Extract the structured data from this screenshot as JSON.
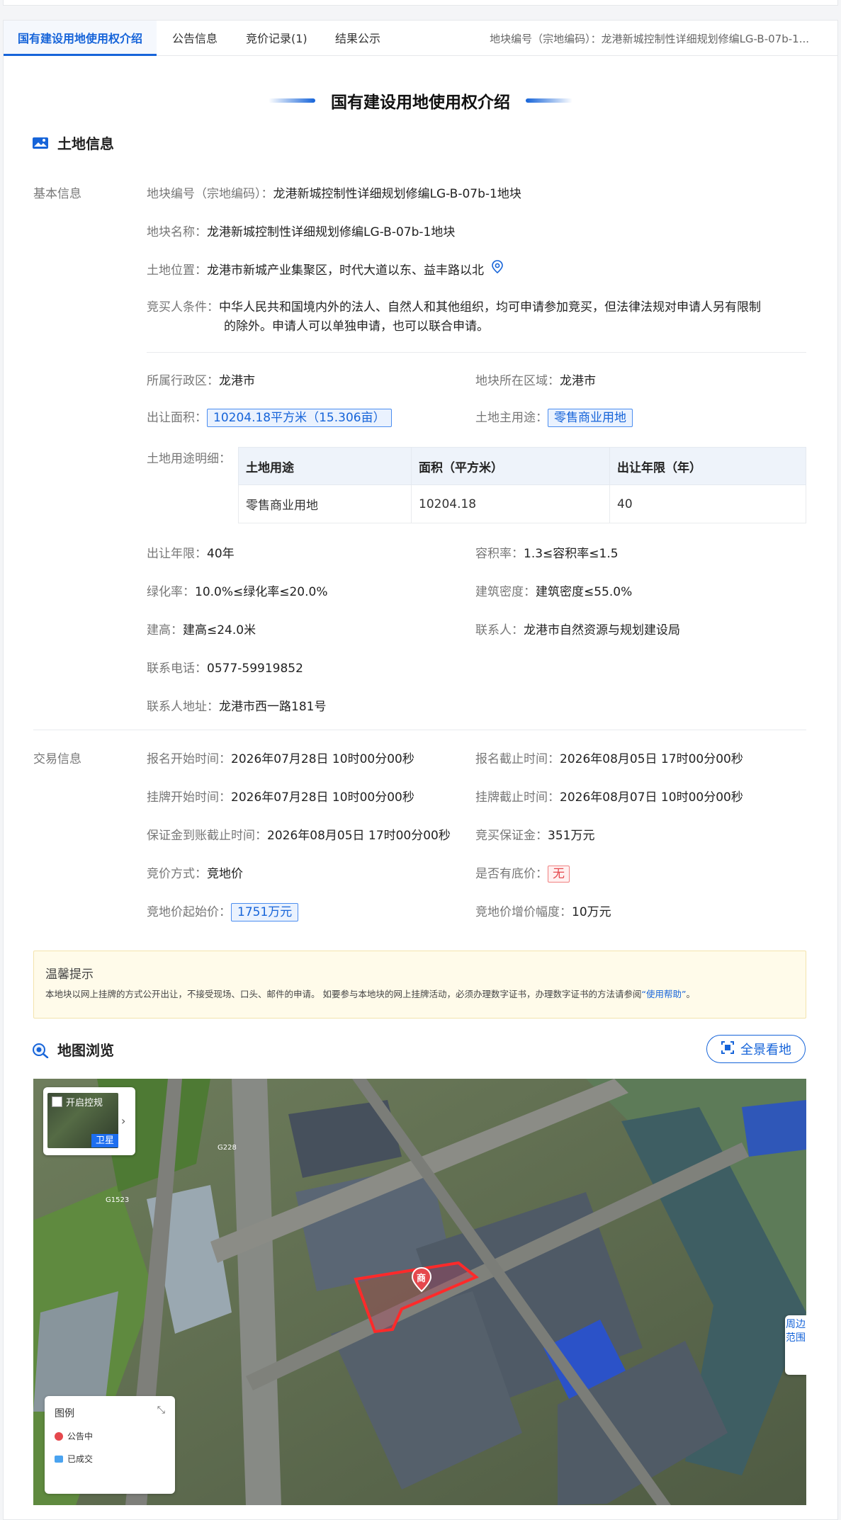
{
  "tabs": [
    {
      "label": "国有建设用地使用权介绍"
    },
    {
      "label": "公告信息"
    },
    {
      "label": "竞价记录(1)"
    },
    {
      "label": "结果公示"
    }
  ],
  "tab_code": "地块编号（宗地编码）：龙港新城控制性详细规划修编LG-B-07b-1...",
  "page_heading": "国有建设用地使用权介绍",
  "land_section": {
    "title": "土地信息",
    "basic_label": "基本信息",
    "code_label": "地块编号（宗地编码）：",
    "code_value": "龙港新城控制性详细规划修编LG-B-07b-1地块",
    "name_label": "地块名称：",
    "name_value": "龙港新城控制性详细规划修编LG-B-07b-1地块",
    "location_label": "土地位置：",
    "location_value": "龙港市新城产业集聚区，时代大道以东、益丰路以北",
    "condition_label": "竞买人条件：",
    "condition_line1": "中华人民共和国境内外的法人、自然人和其他组织，均可申请参加竞买，但法律法规对申请人另有限制",
    "condition_line2": "的除外。申请人可以单独申请，也可以联合申请。",
    "district_label": "所属行政区：",
    "district_value": "龙港市",
    "region_label": "地块所在区域：",
    "region_value": "龙港市",
    "area_label": "出让面积：",
    "area_value": "10204.18平方米（15.306亩）",
    "use_label": "土地主用途：",
    "use_value": "零售商业用地",
    "detail_label": "土地用途明细：",
    "use_table": {
      "headers": [
        "土地用途",
        "面积（平方米）",
        "出让年限（年）"
      ],
      "rows": [
        [
          "零售商业用地",
          "10204.18",
          "40"
        ]
      ]
    },
    "term_label": "出让年限：",
    "term_value": "40年",
    "far_label": "容积率：",
    "far_value": "1.3≤容积率≤1.5",
    "green_label": "绿化率：",
    "green_value": "10.0%≤绿化率≤20.0%",
    "density_label": "建筑密度：",
    "density_value": "建筑密度≤55.0%",
    "height_label": "建高：",
    "height_value": "建高≤24.0米",
    "contact_label": "联系人：",
    "contact_value": "龙港市自然资源与规划建设局",
    "phone_label": "联系电话：",
    "phone_value": "0577-59919852",
    "address_label": "联系人地址：",
    "address_value": "龙港市西一路181号"
  },
  "trade_section": {
    "label": "交易信息",
    "reg_start_label": "报名开始时间：",
    "reg_start_value": "2026年07月28日 10时00分00秒",
    "reg_end_label": "报名截止时间：",
    "reg_end_value": "2026年08月05日 17时00分00秒",
    "list_start_label": "挂牌开始时间：",
    "list_start_value": "2026年07月28日 10时00分00秒",
    "list_end_label": "挂牌截止时间：",
    "list_end_value": "2026年08月07日 10时00分00秒",
    "deposit_deadline_label": "保证金到账截止时间：",
    "deposit_deadline_value": "2026年08月05日 17时00分00秒",
    "deposit_label": "竞买保证金：",
    "deposit_value": "351万元",
    "method_label": "竞价方式：",
    "method_value": "竞地价",
    "reserve_label": "是否有底价：",
    "reserve_value": "无",
    "start_price_label": "竞地价起始价：",
    "start_price_value": "1751万元",
    "increment_label": "竞地价增价幅度：",
    "increment_value": "10万元"
  },
  "tip": {
    "title": "温馨提示",
    "text": "本地块以网上挂牌的方式公开出让，不接受现场、口头、邮件的申请。 如要参与本地块的网上挂牌活动，必须办理数字证书，办理数字证书的方法请参阅",
    "link": "“使用帮助”",
    "suffix": "。"
  },
  "map_section": {
    "title": "地图浏览",
    "pano_button": "全景看地",
    "control_label": "开启控规",
    "satellite_label": "卫星",
    "legend_title": "图例",
    "legend_items": [
      "公告中",
      "已成交"
    ],
    "side_tab": "周边范围",
    "road_labels": [
      "G1523",
      "G228"
    ],
    "marker_label": "商"
  },
  "colors": {
    "accent": "#1664d9",
    "danger": "#e5484d",
    "tip_bg": "#fffbea"
  }
}
